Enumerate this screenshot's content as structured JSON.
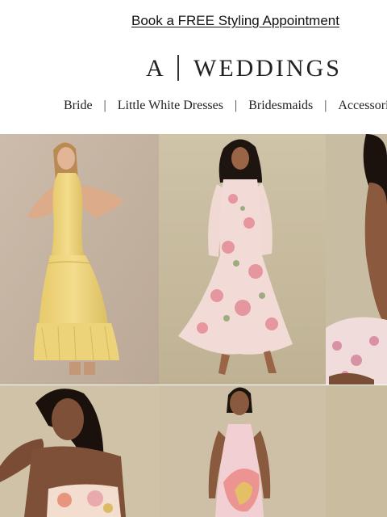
{
  "promo": {
    "link_text": "Book a FREE Styling Appointment"
  },
  "brand": {
    "mark": "A",
    "name": "WEDDINGS"
  },
  "nav": {
    "items": [
      {
        "label": "Bride"
      },
      {
        "label": "Little White Dresses"
      },
      {
        "label": "Bridesmaids"
      },
      {
        "label": "Accessories"
      }
    ],
    "separator": "|"
  },
  "colors": {
    "backdrop_warm": "#c9b9a6",
    "backdrop_olive": "#c8bc9f",
    "yellow_dress": "#efd67e",
    "floral_dress": "#f1d8d4",
    "skin_light": "#d8a888",
    "skin_dark": "#8a5a3e"
  },
  "products": [
    {
      "name": "yellow-halter-tiered-gown"
    },
    {
      "name": "pink-floral-long-sleeve-dress"
    },
    {
      "name": "floral-gown-crop"
    },
    {
      "name": "floral-strapless-dress"
    },
    {
      "name": "pink-floral-halter-dress"
    },
    {
      "name": "backdrop-crop"
    }
  ]
}
